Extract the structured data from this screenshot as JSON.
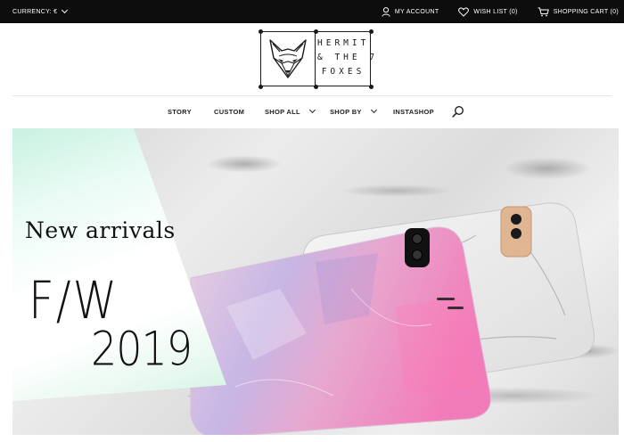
{
  "topbar": {
    "currency_label": "CURRENCY: €",
    "account_label": "MY ACCOUNT",
    "wishlist_label": "WISH LIST (0)",
    "cart_label": "SHOPPING CART (0)"
  },
  "logo": {
    "text": "HERMIT\n& THE 7\nFOXES"
  },
  "nav": {
    "items": [
      {
        "label": "STORY"
      },
      {
        "label": "CUSTOM"
      },
      {
        "label": "SHOP ALL"
      },
      {
        "label": "SHOP BY"
      },
      {
        "label": "INSTASHOP"
      }
    ]
  },
  "hero": {
    "line1": "New arrivals",
    "line2": "F/W",
    "line3": "2019"
  },
  "icons": {
    "account": "user-icon",
    "wishlist": "heart-icon",
    "cart": "cart-icon",
    "search": "search-icon",
    "dropdown": "chevron-down-icon"
  }
}
